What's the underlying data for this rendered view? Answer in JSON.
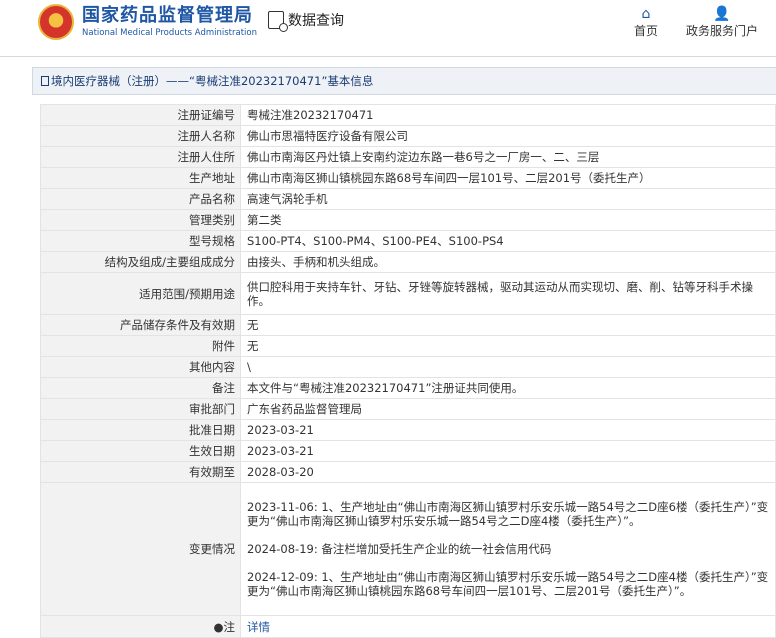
{
  "header": {
    "logo_cn": "国家药品监督管理局",
    "logo_en": "National Medical Products Administration",
    "query_label": "数据查询",
    "nav_home": "首页",
    "nav_services": "政务服务门户"
  },
  "breadcrumb": {
    "section": "境内医疗器械（注册）",
    "separator": "——",
    "record": "“粤械注准20232170471”基本信息"
  },
  "rows": [
    {
      "label": "注册证编号",
      "value": "粤械注准20232170471"
    },
    {
      "label": "注册人名称",
      "value": "佛山市思福特医疗设备有限公司"
    },
    {
      "label": "注册人住所",
      "value": "佛山市南海区丹灶镇上安南约淀边东路一巷6号之一厂房一、二、三层"
    },
    {
      "label": "生产地址",
      "value": "佛山市南海区狮山镇桃园东路68号车间四一层101号、二层201号（委托生产）"
    },
    {
      "label": "产品名称",
      "value": "高速气涡轮手机"
    },
    {
      "label": "管理类别",
      "value": "第二类"
    },
    {
      "label": "型号规格",
      "value": "S100-PT4、S100-PM4、S100-PE4、S100-PS4"
    },
    {
      "label": "结构及组成/主要组成成分",
      "value": "由接头、手柄和机头组成。"
    },
    {
      "label": "适用范围/预期用途",
      "value": "供口腔科用于夹持车针、牙钻、牙锉等旋转器械，驱动其运动从而实现切、磨、削、钻等牙科手术操作。"
    },
    {
      "label": "产品储存条件及有效期",
      "value": "无"
    },
    {
      "label": "附件",
      "value": "无"
    },
    {
      "label": "其他内容",
      "value": "\\"
    },
    {
      "label": "备注",
      "value": "本文件与“粤械注准20232170471”注册证共同使用。"
    },
    {
      "label": "审批部门",
      "value": "广东省药品监督管理局"
    },
    {
      "label": "批准日期",
      "value": "2023-03-21"
    },
    {
      "label": "生效日期",
      "value": "2023-03-21"
    },
    {
      "label": "有效期至",
      "value": "2028-03-20"
    }
  ],
  "changes": {
    "label": "变更情况",
    "entries": [
      "2023-11-06: 1、生产地址由“佛山市南海区狮山镇罗村乐安乐城一路54号之二D座6楼（委托生产）”变更为“佛山市南海区狮山镇罗村乐安乐城一路54号之二D座4楼（委托生产）”。",
      "2024-08-19: 备注栏增加受托生产企业的统一社会信用代码",
      "2024-12-09: 1、生产地址由“佛山市南海区狮山镇罗村乐安乐城一路54号之二D座4楼（委托生产）”变更为“佛山市南海区狮山镇桃园东路68号车间四一层101号、二层201号（委托生产）”。"
    ]
  },
  "note": {
    "label": "注",
    "link": "详情"
  }
}
